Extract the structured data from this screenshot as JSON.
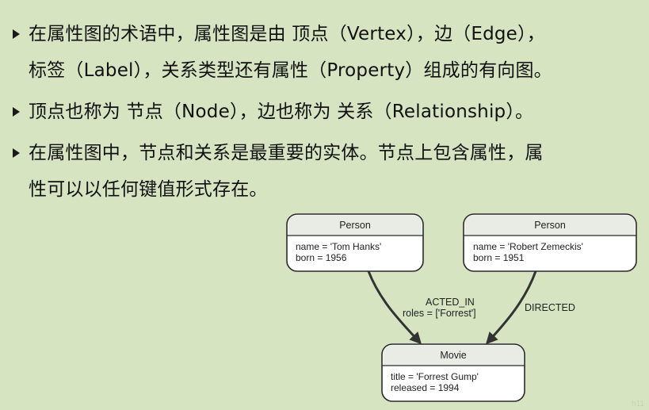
{
  "bullets": [
    {
      "lines": [
        "在属性图的术语中，属性图是由 顶点（Vertex），边（Edge），",
        "标签（Label），关系类型还有属性（Property）组成的有向图。"
      ]
    },
    {
      "lines": [
        "顶点也称为 节点（Node），边也称为 关系（Relationship）。"
      ]
    },
    {
      "lines": [
        "在属性图中，节点和关系是最重要的实体。节点上包含属性，属",
        "性可以以任何键值形式存在。"
      ]
    }
  ],
  "diagram": {
    "nodes": {
      "person1": {
        "label": "Person",
        "props": [
          "name = 'Tom Hanks'",
          "born = 1956"
        ]
      },
      "person2": {
        "label": "Person",
        "props": [
          "name = 'Robert Zemeckis'",
          "born = 1951"
        ]
      },
      "movie": {
        "label": "Movie",
        "props": [
          "title = 'Forrest Gump'",
          "released = 1994"
        ]
      }
    },
    "edges": {
      "acted_in": {
        "label": "ACTED_IN",
        "props": [
          "roles = ['Forrest']"
        ]
      },
      "directed": {
        "label": "DIRECTED"
      }
    }
  },
  "watermark": "h11"
}
